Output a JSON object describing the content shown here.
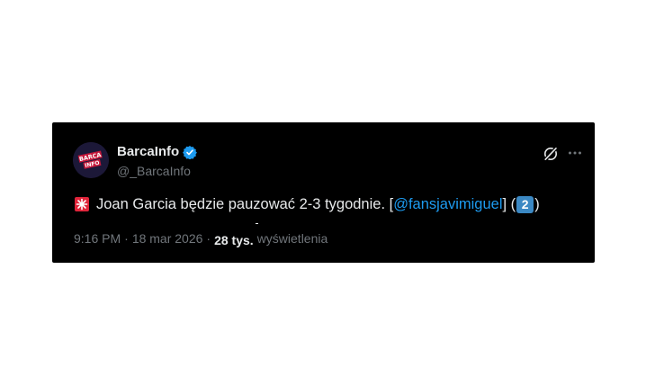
{
  "author": {
    "name": "BarcaInfo",
    "handle": "@_BarcaInfo",
    "avatar_text_top": "BARCA",
    "avatar_text_bottom": "INFO",
    "verified": true
  },
  "tweet": {
    "text_main": "Joan Garcia będzie pauzować 2-3 tygodnie. [",
    "mention": "@fansjavimiguel",
    "text_after_mention": "] (",
    "keycap": "2",
    "text_end": ")"
  },
  "meta": {
    "time": "9:16 PM",
    "separator": "·",
    "date": "18 mar 2026",
    "separator2": "·",
    "views_count": "28 tys.",
    "views_label": "wyświetlenia"
  },
  "icons": {
    "verified": "verified-badge-icon",
    "grok": "grok-icon",
    "more": "more-options-icon",
    "siren": "siren-emoji-icon"
  },
  "colors": {
    "background": "#000000",
    "text": "#e7e9ea",
    "muted": "#71767b",
    "link": "#1d9bf0"
  }
}
